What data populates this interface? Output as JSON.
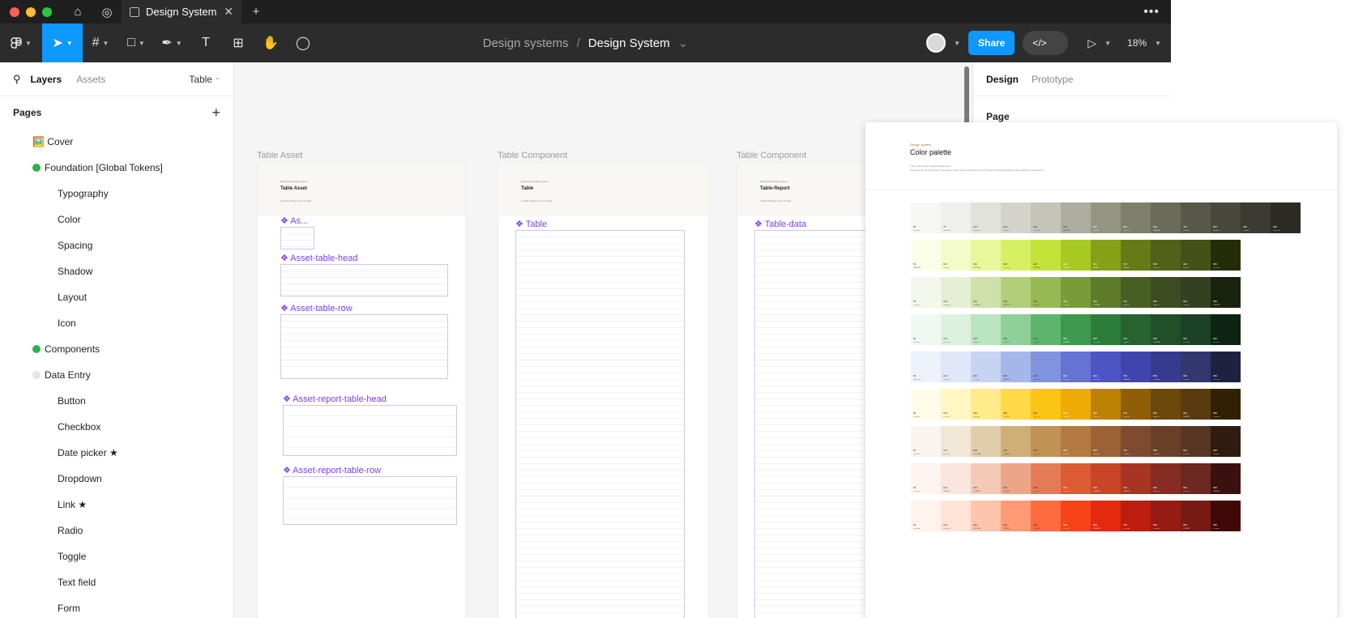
{
  "titlebar": {
    "tab_title": "Design System",
    "tab_close": "✕",
    "new_tab": "+",
    "more": "•••"
  },
  "toolbar": {
    "project": "Design systems",
    "separator": "/",
    "file": "Design System",
    "file_caret": "⌄",
    "share_label": "Share",
    "devmode_label": "</>",
    "zoom": "18%"
  },
  "left_panel": {
    "tab_layers": "Layers",
    "tab_assets": "Assets",
    "page_select": "Table",
    "pages_header": "Pages",
    "add": "+",
    "pages": [
      {
        "label": "🖼️ Cover",
        "level": 0
      },
      {
        "label": "Foundation [Global Tokens]",
        "level": 0,
        "dot": "#2db34a"
      },
      {
        "label": "Typography",
        "level": 1
      },
      {
        "label": "Color",
        "level": 1
      },
      {
        "label": "Spacing",
        "level": 1
      },
      {
        "label": "Shadow",
        "level": 1
      },
      {
        "label": "Layout",
        "level": 1
      },
      {
        "label": "Icon",
        "level": 1
      },
      {
        "label": "Components",
        "level": 0,
        "dot": "#2db34a"
      },
      {
        "label": "Data Entry",
        "level": 0,
        "dot": "#e6e6e6"
      },
      {
        "label": "Button",
        "level": 1
      },
      {
        "label": "Checkbox",
        "level": 1
      },
      {
        "label": "Date picker ★",
        "level": 1
      },
      {
        "label": "Dropdown",
        "level": 1
      },
      {
        "label": "Link ★",
        "level": 1
      },
      {
        "label": "Radio",
        "level": 1
      },
      {
        "label": "Toggle",
        "level": 1
      },
      {
        "label": "Text field",
        "level": 1
      },
      {
        "label": "Form",
        "level": 1
      }
    ]
  },
  "canvas": {
    "frames": [
      {
        "label": "Table Asset",
        "super": "Enterprise design system",
        "title": "Table Asset",
        "desc": "A table displays rows of data.",
        "components": [
          "❖ As...",
          "❖ Asset-table-head",
          "❖ Asset-table-row",
          "❖ Asset-report-table-head",
          "❖ Asset-report-table-row"
        ]
      },
      {
        "label": "Table Component",
        "super": "Enterprise design system",
        "title": "Table",
        "desc": "A table displays rows of data.",
        "components": [
          "❖ Table"
        ]
      },
      {
        "label": "Table Component",
        "super": "Enterprise design system",
        "title": "Table-Report",
        "desc": "A table displays rows of data.",
        "components": [
          "❖ Table-data"
        ]
      }
    ]
  },
  "right_panel": {
    "tab_design": "Design",
    "tab_prototype": "Prototype",
    "section_page": "Page"
  },
  "palette_preview": {
    "super": "Design system",
    "title": "Color palette",
    "desc1": "This version had manual adjustments.",
    "desc2": "Note that not all colors are in the Figma style, refer to the board if more colors should be added to the frequently used colors",
    "ramps": [
      {
        "labels": [
          "50",
          "75",
          "100",
          "150",
          "200",
          "300",
          "400",
          "500",
          "600",
          "700",
          "800",
          "900",
          "950"
        ],
        "colors": [
          "#f6f6f4",
          "#efefeb",
          "#e2e2dc",
          "#d4d4cc",
          "#c4c4b9",
          "#adad9f",
          "#959584",
          "#7f7f6d",
          "#6b6b5a",
          "#585849",
          "#48483c",
          "#3b3b31",
          "#2c2c24"
        ]
      },
      {
        "labels": [
          "50",
          "100",
          "200",
          "300",
          "400",
          "500",
          "600",
          "700",
          "800",
          "900",
          "950"
        ],
        "colors": [
          "#fafde8",
          "#f3fbc9",
          "#e7f79a",
          "#d7f062",
          "#c4e33a",
          "#a8c922",
          "#86a017",
          "#667a16",
          "#526118",
          "#445219",
          "#242d08"
        ]
      },
      {
        "labels": [
          "50",
          "100",
          "200",
          "300",
          "400",
          "500",
          "600",
          "700",
          "800",
          "900",
          "950"
        ],
        "colors": [
          "#f4f8ec",
          "#e6efd4",
          "#cfe1ab",
          "#b2ce7a",
          "#96b953",
          "#789c38",
          "#5d7b2a",
          "#485f24",
          "#3b4c21",
          "#334120",
          "#1a230d"
        ]
      },
      {
        "labels": [
          "50",
          "100",
          "200",
          "300",
          "400",
          "500",
          "600",
          "700",
          "800",
          "900",
          "950"
        ],
        "colors": [
          "#f0f9f1",
          "#dcf2df",
          "#bbe4c1",
          "#8fcf99",
          "#5fb46d",
          "#3d9a4d",
          "#2c7d3b",
          "#266331",
          "#214f2a",
          "#1d4124",
          "#0c2411"
        ]
      },
      {
        "labels": [
          "50",
          "100",
          "200",
          "300",
          "400",
          "500",
          "600",
          "700",
          "800",
          "900",
          "950"
        ],
        "colors": [
          "#eef2fb",
          "#e0e7f8",
          "#c7d3f2",
          "#a5b6e9",
          "#8193de",
          "#6573d3",
          "#4d55c5",
          "#4045ad",
          "#373b8d",
          "#323770",
          "#1f2141"
        ]
      },
      {
        "labels": [
          "50",
          "100",
          "200",
          "300",
          "400",
          "500",
          "600",
          "700",
          "800",
          "900",
          "950"
        ],
        "colors": [
          "#fefbe8",
          "#fff6c2",
          "#ffeb89",
          "#ffd946",
          "#fcc414",
          "#ecab07",
          "#bc8203",
          "#8f5e06",
          "#6b470c",
          "#5a3b10",
          "#322005"
        ]
      },
      {
        "labels": [
          "50",
          "100",
          "200",
          "300",
          "400",
          "500",
          "600",
          "700",
          "800",
          "900",
          "950"
        ],
        "colors": [
          "#f9f5ee",
          "#f0e7d6",
          "#e1cdaa",
          "#cfae78",
          "#c09253",
          "#b37b41",
          "#9b6236",
          "#7e4b2f",
          "#684029",
          "#573624",
          "#301b11"
        ]
      },
      {
        "labels": [
          "50",
          "100",
          "200",
          "300",
          "400",
          "500",
          "600",
          "700",
          "800",
          "900",
          "950"
        ],
        "colors": [
          "#fdf4ef",
          "#fae6dc",
          "#f4cab6",
          "#eca687",
          "#e37c56",
          "#dc5c33",
          "#ca4428",
          "#a83423",
          "#862c23",
          "#6c2720",
          "#3a110e"
        ]
      },
      {
        "labels": [
          "50",
          "100",
          "200",
          "300",
          "400",
          "500",
          "600",
          "700",
          "800",
          "900",
          "950"
        ],
        "colors": [
          "#fff3ee",
          "#ffe3d6",
          "#ffc4ab",
          "#ff9a75",
          "#fd6a3d",
          "#f64318",
          "#e32a0e",
          "#bc1d0f",
          "#951b14",
          "#781a14",
          "#410808"
        ]
      }
    ]
  }
}
